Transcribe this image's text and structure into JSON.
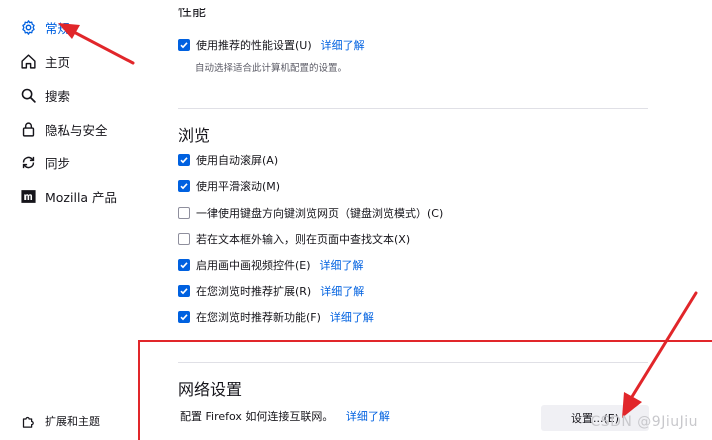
{
  "sidebar": {
    "items": [
      {
        "label": "常规",
        "icon": "gear-icon",
        "active": true
      },
      {
        "label": "主页",
        "icon": "home-icon"
      },
      {
        "label": "搜索",
        "icon": "search-icon"
      },
      {
        "label": "隐私与安全",
        "icon": "lock-icon"
      },
      {
        "label": "同步",
        "icon": "sync-icon"
      },
      {
        "label": "Mozilla 产品",
        "icon": "mozilla-icon"
      }
    ],
    "footer": {
      "label": "扩展和主题",
      "icon": "puzzle-icon"
    }
  },
  "performance": {
    "title_partial": "性能",
    "use_recommended": "使用推荐的性能设置(U)",
    "learn_more": "详细了解",
    "hint": "自动选择适合此计算机配置的设置。"
  },
  "browsing": {
    "title": "浏览",
    "options": [
      {
        "label": "使用自动滚屏(A)",
        "checked": true
      },
      {
        "label": "使用平滑滚动(M)",
        "checked": true
      },
      {
        "label": "一律使用键盘方向键浏览网页（键盘浏览模式）(C)",
        "checked": false
      },
      {
        "label": "若在文本框外输入，则在页面中查找文本(X)",
        "checked": false
      },
      {
        "label": "启用画中画视频控件(E)",
        "checked": true,
        "link": "详细了解"
      },
      {
        "label": "在您浏览时推荐扩展(R)",
        "checked": true,
        "link": "详细了解"
      },
      {
        "label": "在您浏览时推荐新功能(F)",
        "checked": true,
        "link": "详细了解"
      }
    ]
  },
  "network": {
    "title": "网络设置",
    "description": "配置 Firefox 如何连接互联网。",
    "learn_more": "详细了解",
    "button": "设置...(E)"
  },
  "watermark": "CSDN @9JiuJiu",
  "colors": {
    "accent": "#0061e0",
    "annotation": "#e1262a"
  }
}
